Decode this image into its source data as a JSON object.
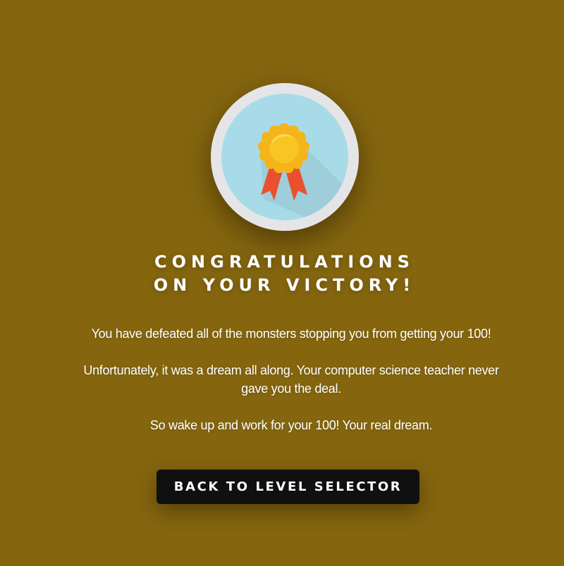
{
  "victory_screen": {
    "badge_icon": "award-rosette-icon",
    "title_line1": "CONGRATULATIONS",
    "title_line2": "ON YOUR VICTORY!",
    "paragraph1": "You have defeated all of the monsters stopping you from getting your 100!",
    "paragraph2": "Unfortunately, it was a dream all along. Your computer science teacher never gave you the deal.",
    "paragraph3": "So wake up and work for your 100! Your real dream.",
    "back_button_label": "BACK TO LEVEL SELECTOR"
  },
  "colors": {
    "background": "#85660f",
    "badge_ring": "#e5e5e8",
    "badge_inner": "#a8dbe8",
    "medal_gold": "#f6c21e",
    "ribbon_red": "#e8502f",
    "button_bg": "#101010",
    "text": "#ffffff"
  }
}
